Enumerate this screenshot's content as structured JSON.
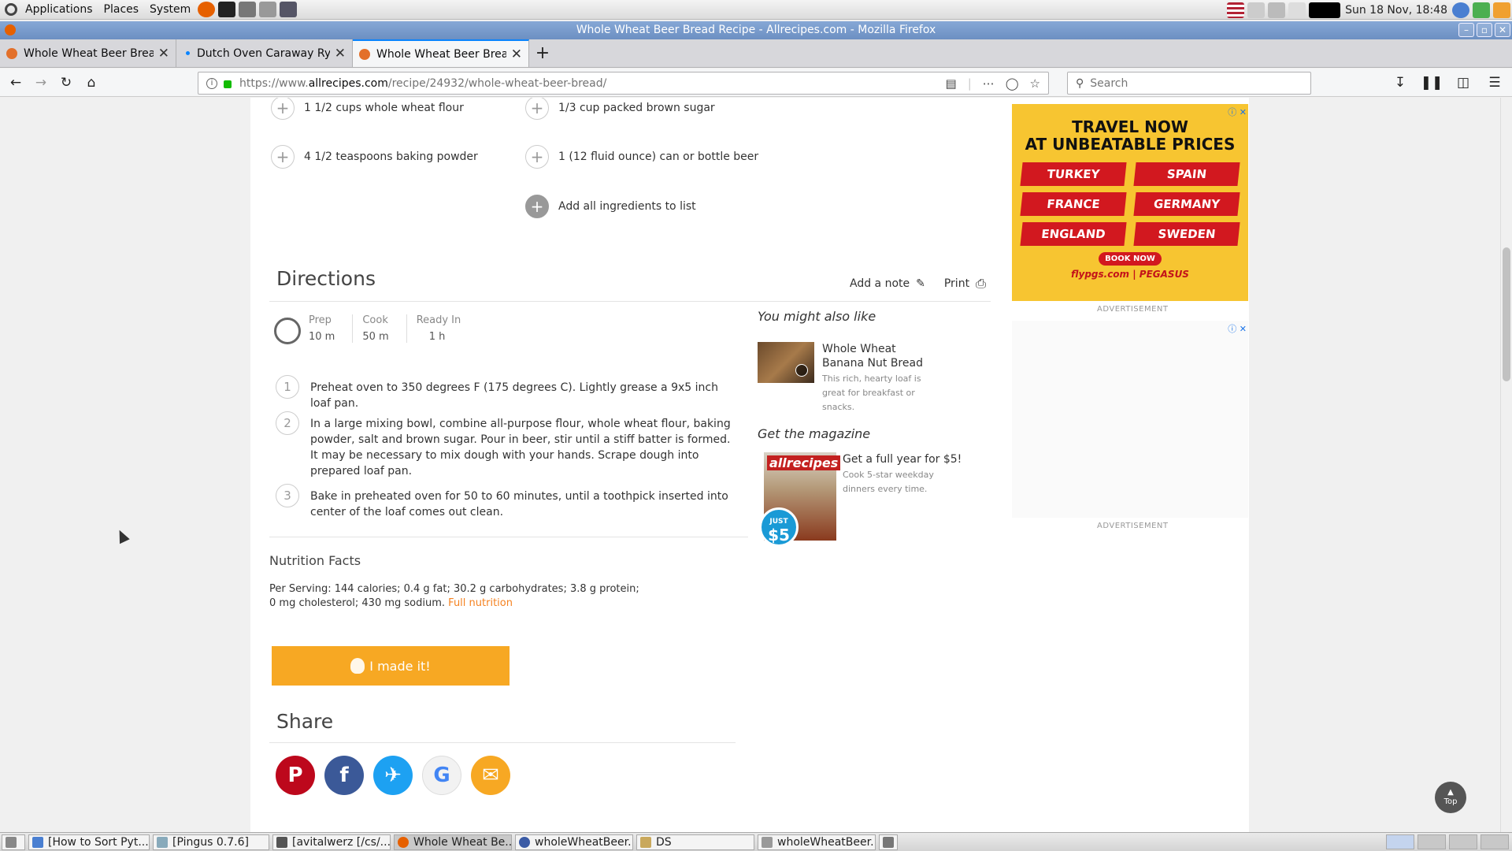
{
  "topbar": {
    "menus": [
      "Applications",
      "Places",
      "System"
    ],
    "clock": "Sun 18 Nov, 18:48"
  },
  "window": {
    "title": "Whole Wheat Beer Bread Recipe - Allrecipes.com - Mozilla Firefox"
  },
  "tabs": [
    {
      "title": "Whole Wheat Beer Bread"
    },
    {
      "title": "Dutch Oven Caraway Rye"
    },
    {
      "title": "Whole Wheat Beer Bread"
    }
  ],
  "nav": {
    "url_prefix": "https://www.",
    "url_domain": "allrecipes.com",
    "url_path": "/recipe/24932/whole-wheat-beer-bread/",
    "search_placeholder": "Search"
  },
  "ingredients": [
    "1 1/2 cups whole wheat flour",
    "1/3 cup packed brown sugar",
    "4 1/2 teaspoons baking powder",
    "1 (12 fluid ounce) can or bottle beer"
  ],
  "add_all_label": "Add all ingredients to list",
  "directions": {
    "heading": "Directions",
    "add_note": "Add a note",
    "print": "Print",
    "times": [
      {
        "label": "Prep",
        "value": "10 m"
      },
      {
        "label": "Cook",
        "value": "50 m"
      },
      {
        "label": "Ready In",
        "value": "1 h"
      }
    ],
    "steps": [
      {
        "num": "1",
        "text": "Preheat oven to 350 degrees F (175 degrees C). Lightly grease a 9x5 inch loaf pan."
      },
      {
        "num": "2",
        "text": "In a large mixing bowl, combine all-purpose flour, whole wheat flour, baking powder, salt and brown sugar. Pour in beer, stir until a stiff batter is formed. It may be necessary to mix dough with your hands. Scrape dough into prepared loaf pan."
      },
      {
        "num": "3",
        "text": "Bake in preheated oven for 50 to 60 minutes, until a toothpick inserted into center of the loaf comes out clean."
      }
    ]
  },
  "sidebar": {
    "also_like_heading": "You might also like",
    "also_like_title": "Whole Wheat Banana Nut Bread",
    "also_like_desc": "This rich, hearty loaf is great for breakfast or snacks.",
    "magazine_heading": "Get the magazine",
    "magazine_title": "Get a full year for $5!",
    "magazine_desc": "Cook 5-star weekday dinners every time.",
    "magazine_brand": "allrecipes",
    "magazine_badge_top": "JUST",
    "magazine_badge_price": "$5"
  },
  "ad": {
    "headline_1": "TRAVEL NOW",
    "headline_2": "AT UNBEATABLE PRICES",
    "countries": [
      "TURKEY",
      "SPAIN",
      "FRANCE",
      "GERMANY",
      "ENGLAND",
      "SWEDEN"
    ],
    "cta": "BOOK NOW",
    "brand": "flypgs.com | PEGASUS",
    "label": "ADVERTISEMENT"
  },
  "nutrition": {
    "heading": "Nutrition Facts",
    "text": "Per Serving: 144 calories; 0.4 g fat; 30.2 g carbohydrates; 3.8 g protein; 0 mg cholesterol; 430 mg sodium.",
    "link": "Full nutrition"
  },
  "made_it_label": "I made it!",
  "share": {
    "heading": "Share"
  },
  "top_button": "Top",
  "taskbar": [
    "[How to Sort Pyt...",
    "[Pingus 0.7.6]",
    "[avitalwerz [/cs/...",
    "Whole Wheat Be...",
    "wholeWheatBeer...",
    "DS",
    "wholeWheatBeer..."
  ],
  "colors": {
    "accent": "#f58220",
    "made_it": "#f7a823",
    "ad_bg": "#f7c531",
    "ad_red": "#d2181f",
    "pinterest": "#bd081c",
    "facebook": "#3b5998",
    "twitter": "#1da1f2",
    "email": "#f7a823"
  }
}
